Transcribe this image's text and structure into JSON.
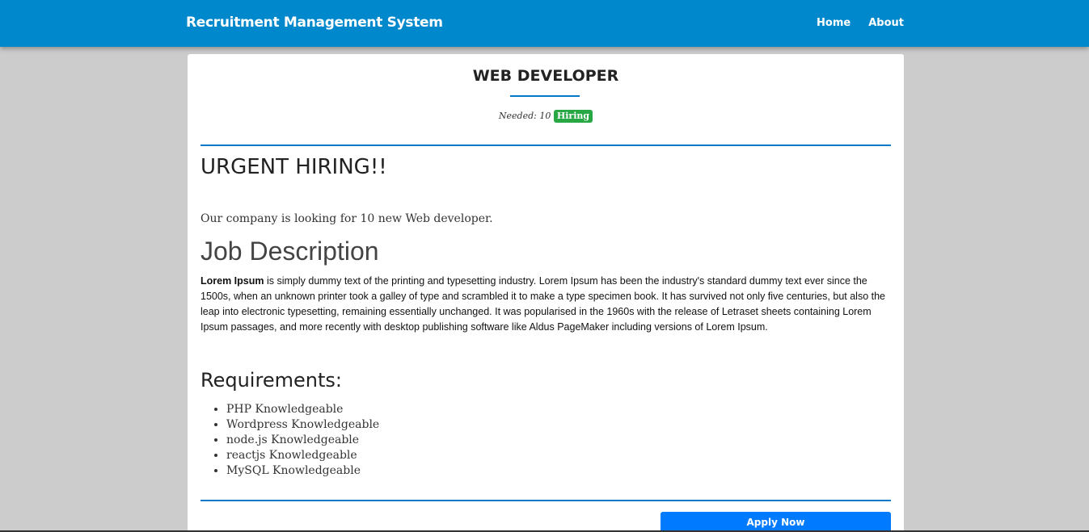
{
  "navbar": {
    "brand": "Recruitment Management System",
    "links": [
      {
        "label": "Home"
      },
      {
        "label": "About"
      }
    ]
  },
  "job": {
    "title": "WEB DEVELOPER",
    "needed_label": "Needed: 10",
    "status_badge": "Hiring",
    "headline": "URGENT HIRING!!",
    "lead": "Our company is looking for 10 new Web developer.",
    "description_heading": "Job Description",
    "description_bold": "Lorem Ipsum",
    "description_text": " is simply dummy text of the printing and typesetting industry. Lorem Ipsum has been the industry's standard dummy text ever since the 1500s, when an unknown printer took a galley of type and scrambled it to make a type specimen book. It has survived not only five centuries, but also the leap into electronic typesetting, remaining essentially unchanged. It was popularised in the 1960s with the release of Letraset sheets containing Lorem Ipsum passages, and more recently with desktop publishing software like Aldus PageMaker including versions of Lorem Ipsum.",
    "requirements_heading": "Requirements:",
    "requirements": [
      "PHP Knowledgeable",
      "Wordpress Knowledgeable",
      "node.js Knowledgeable",
      "reactjs Knowledgeable",
      "MySQL Knowledgeable"
    ],
    "apply_label": "Apply Now"
  },
  "colors": {
    "navbar_bg": "#0088cc",
    "accent_rule": "#0078c8",
    "badge_bg": "#28a745",
    "apply_bg": "#007bff",
    "page_bg": "#cccccc"
  }
}
